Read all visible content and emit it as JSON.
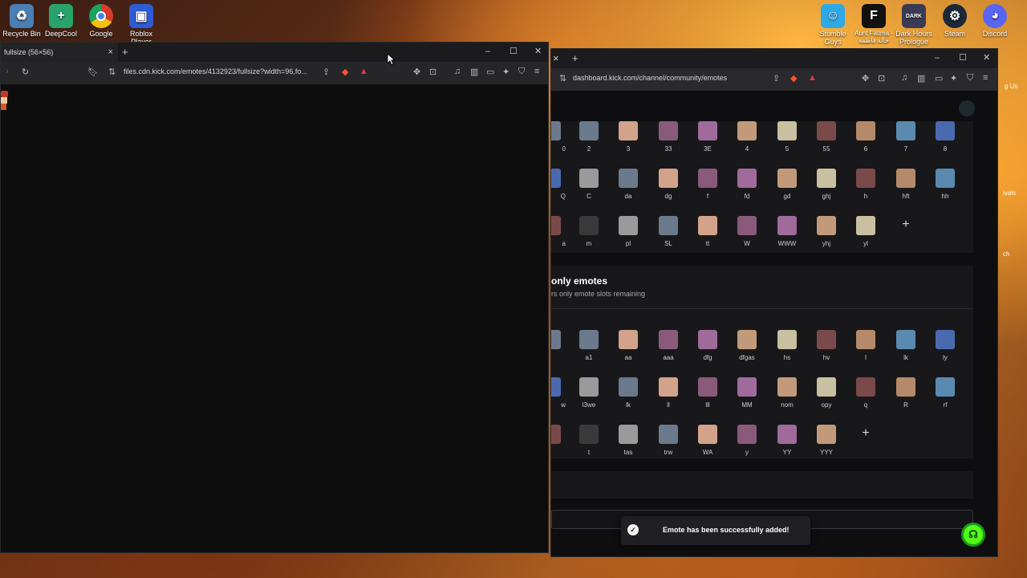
{
  "desktop": {
    "icons": [
      {
        "label": "Recycle Bin",
        "icon": "recycle-bin-icon",
        "color": "#4a7fb3"
      },
      {
        "label": "DeepCool",
        "icon": "deepcool-icon",
        "color": "#27a36b"
      },
      {
        "label": "Google",
        "icon": "chrome-icon",
        "color": "#d33b2c"
      },
      {
        "label": "Roblox Player",
        "icon": "roblox-icon",
        "color": "#2f5bd3"
      },
      {
        "label": "Stumble Guys",
        "icon": "stumble-guys-icon",
        "color": "#2fa9e6"
      },
      {
        "label": "Aunt Fatima - خالة فاطمة",
        "icon": "aunt-fatima-icon",
        "color": "#111111"
      },
      {
        "label": "Dark Hours Prologue",
        "icon": "dark-hours-icon",
        "color": "#3a3a55"
      },
      {
        "label": "Steam",
        "icon": "steam-icon",
        "color": "#1b2838"
      },
      {
        "label": "Discord",
        "icon": "discord-icon",
        "color": "#5865f2"
      }
    ],
    "right_edge_labels": [
      "g Us",
      "ivals",
      "ch"
    ]
  },
  "left_window": {
    "tab_title": "fullsize (56×56)",
    "url": "files.cdn.kick.com/emotes/4132923/fullsize?width=96,fo..."
  },
  "right_window": {
    "url": "dashboard.kick.com/channel/community/emotes",
    "grid1": {
      "rows": [
        [
          "2",
          "3",
          "33",
          "3E",
          "4",
          "5",
          "55",
          "6",
          "7",
          "8"
        ],
        [
          "C",
          "da",
          "dg",
          "f",
          "fd",
          "gd",
          "ghj",
          "h",
          "hft",
          "hh"
        ],
        [
          "m",
          "pl",
          "SL",
          "tt",
          "W",
          "WWW",
          "yhj",
          "yl"
        ]
      ],
      "left_partials": [
        "0",
        "Q",
        "a"
      ]
    },
    "section2": {
      "title": "only emotes",
      "subtitle": "rs only emote slots remaining",
      "rows": [
        [
          "a1",
          "aa",
          "aaa",
          "dfg",
          "dfgas",
          "hs",
          "hv",
          "l",
          "lk",
          "ly"
        ],
        [
          "l3we",
          "lk",
          "ll",
          "lll",
          "MM",
          "nom",
          "opy",
          "q",
          "R",
          "rf"
        ],
        [
          "t",
          "tas",
          "trw",
          "WA",
          "y",
          "YY",
          "YYY"
        ]
      ],
      "left_partials": [
        "",
        "w",
        ""
      ]
    },
    "toast": {
      "message": "Emote has been successfully added!"
    }
  }
}
